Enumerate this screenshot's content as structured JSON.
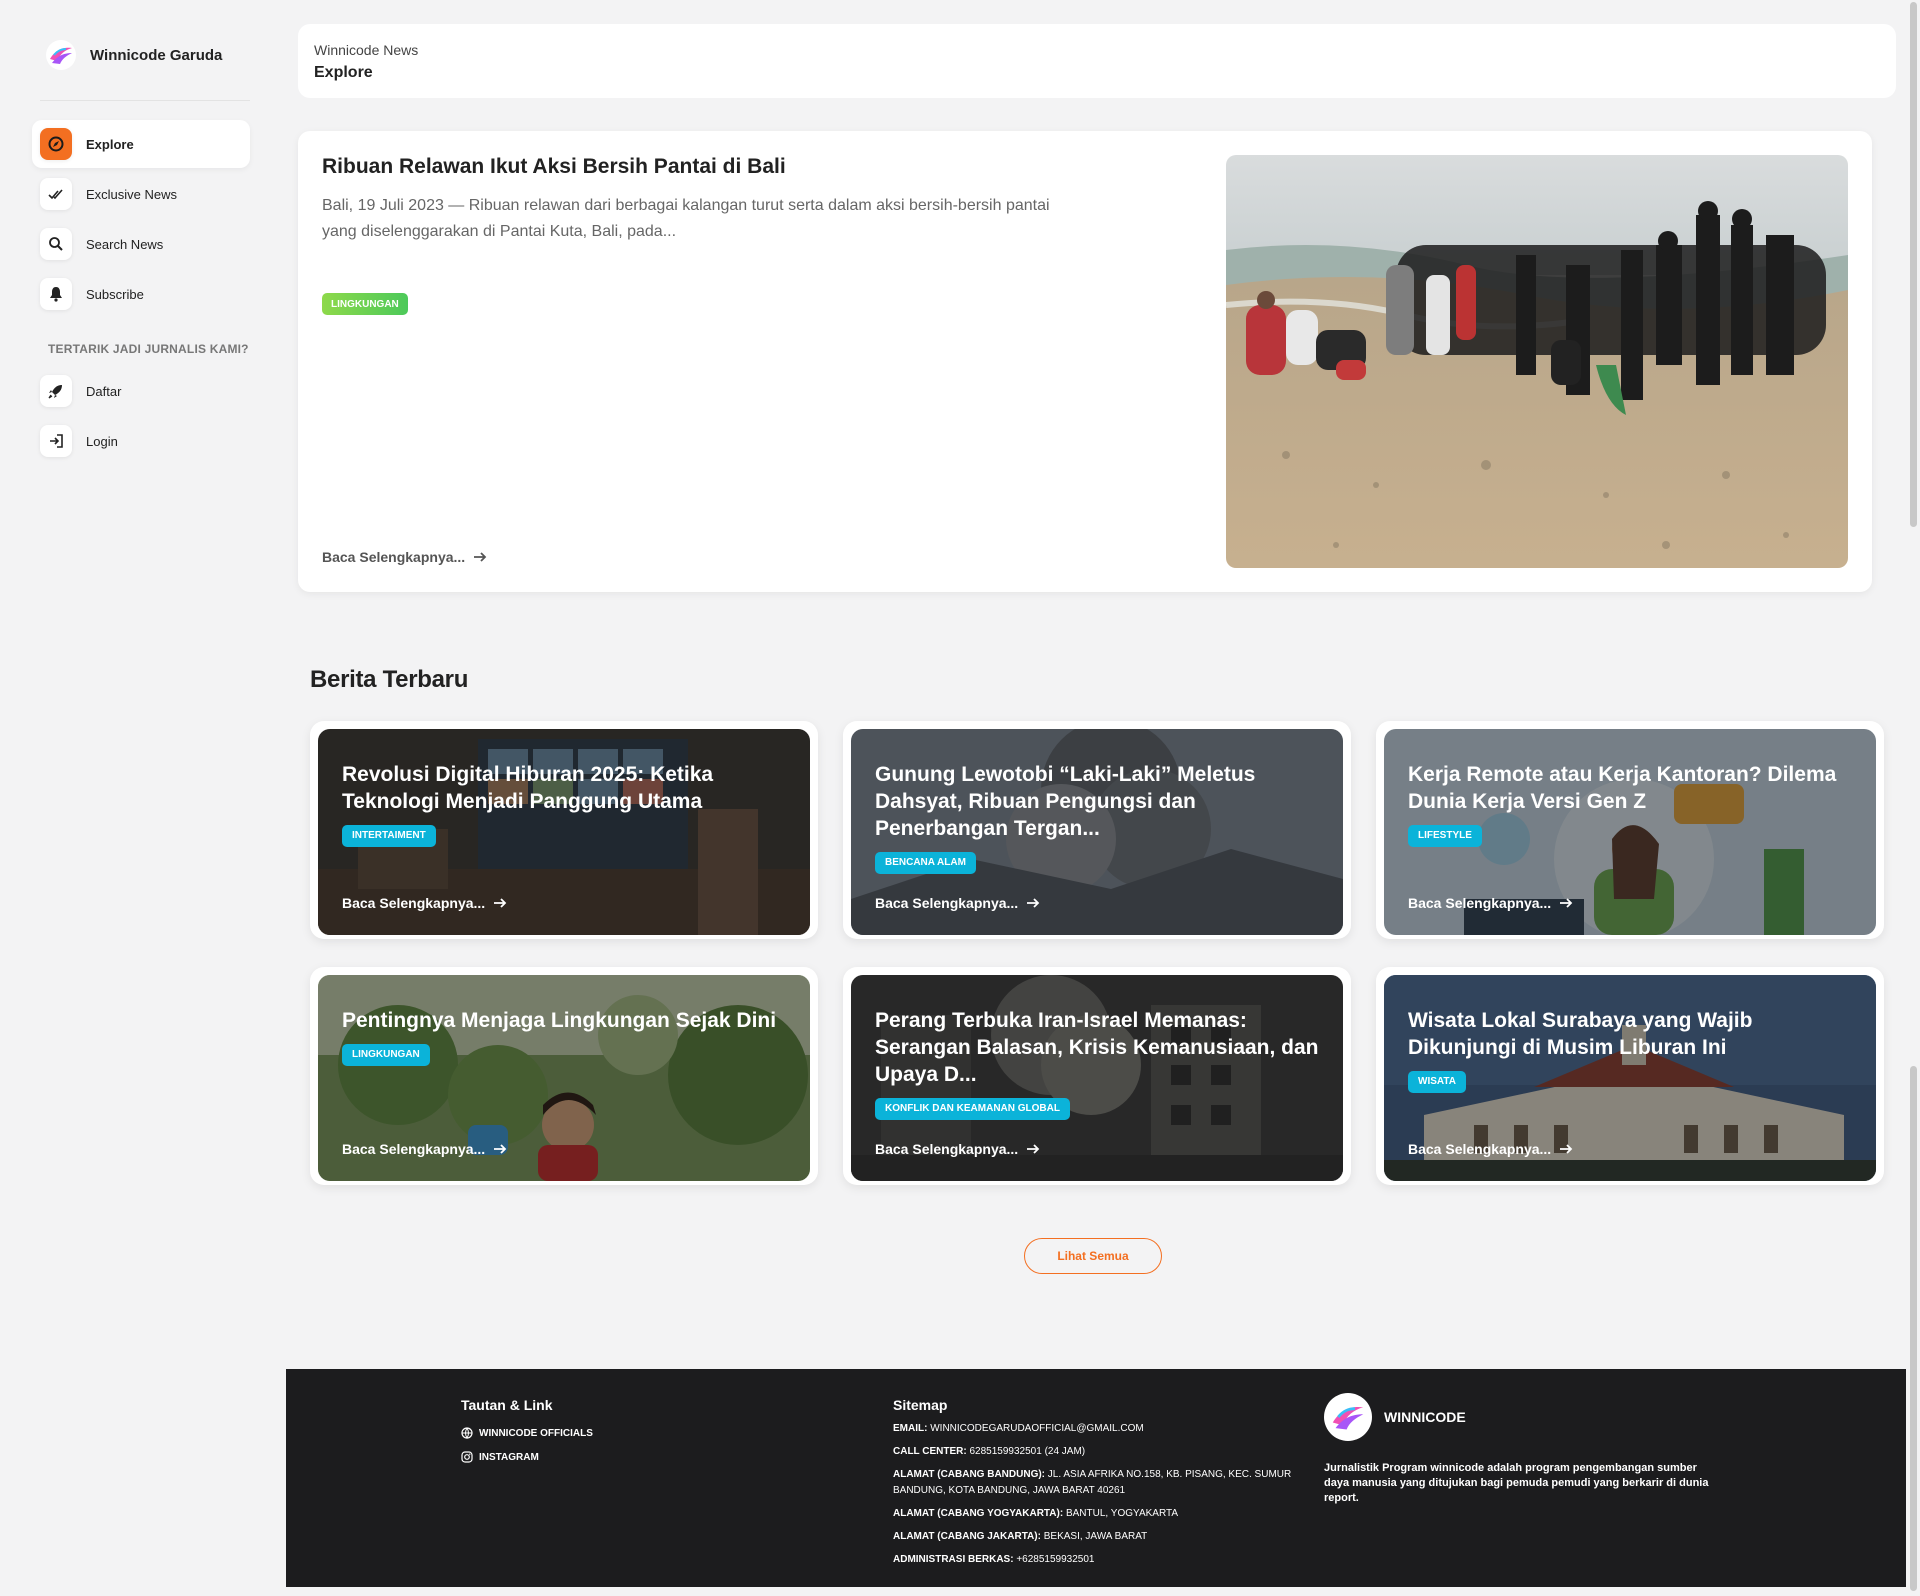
{
  "brand": {
    "name": "Winnicode Garuda"
  },
  "nav": {
    "items": [
      {
        "label": "Explore",
        "icon": "explore-icon"
      },
      {
        "label": "Exclusive News",
        "icon": "check-double-icon"
      },
      {
        "label": "Search News",
        "icon": "search-icon"
      },
      {
        "label": "Subscribe",
        "icon": "bell-icon"
      }
    ],
    "section_label": "TERTARIK JADI JURNALIS KAMI?",
    "account_items": [
      {
        "label": "Daftar",
        "icon": "rocket-icon"
      },
      {
        "label": "Login",
        "icon": "login-icon"
      }
    ]
  },
  "header": {
    "breadcrumb": "Winnicode News",
    "title": "Explore"
  },
  "hero": {
    "title": "Ribuan Relawan Ikut Aksi Bersih Pantai di Bali",
    "excerpt": "Bali, 19 Juli 2023 — Ribuan relawan dari berbagai kalangan turut serta dalam aksi bersih-bersih pantai yang diselenggarakan di Pantai Kuta, Bali, pada...",
    "badge": "LINGKUNGAN",
    "read_more": "Baca Selengkapnya..."
  },
  "latest": {
    "title": "Berita Terbaru",
    "cards": [
      {
        "title": "Revolusi Digital Hiburan 2025: Ketika Teknologi Menjadi Panggung Utama",
        "badge": "INTERTAIMENT",
        "read_more": "Baca Selengkapnya..."
      },
      {
        "title": "Gunung Lewotobi “Laki-Laki” Meletus Dahsyat, Ribuan Pengungsi dan Penerbangan Tergan...",
        "badge": "BENCANA ALAM",
        "read_more": "Baca Selengkapnya..."
      },
      {
        "title": "Kerja Remote atau Kerja Kantoran? Dilema Dunia Kerja Versi Gen Z",
        "badge": "LIFESTYLE",
        "read_more": "Baca Selengkapnya..."
      },
      {
        "title": "Pentingnya Menjaga Lingkungan Sejak Dini",
        "badge": "LINGKUNGAN",
        "read_more": "Baca Selengkapnya..."
      },
      {
        "title": "Perang Terbuka Iran-Israel Memanas: Serangan Balasan, Krisis Kemanusiaan, dan Upaya D...",
        "badge": "KONFLIK DAN KEAMANAN GLOBAL",
        "read_more": "Baca Selengkapnya..."
      },
      {
        "title": "Wisata Lokal Surabaya yang Wajib Dikunjungi di Musim Liburan Ini",
        "badge": "WISATA",
        "read_more": "Baca Selengkapnya..."
      }
    ],
    "see_all": "Lihat Semua"
  },
  "footer": {
    "links_title": "Tautan & Link",
    "links": [
      {
        "label": "WINNICODE OFFICIALS",
        "icon": "globe-icon"
      },
      {
        "label": "INSTAGRAM",
        "icon": "instagram-icon"
      }
    ],
    "sitemap_title": "Sitemap",
    "sitemap": [
      {
        "key": "EMAIL:",
        "value": "WINNICODEGARUDAOFFICIAL@GMAIL.COM"
      },
      {
        "key": "CALL CENTER:",
        "value": "6285159932501 (24 JAM)"
      },
      {
        "key": "ALAMAT (CABANG BANDUNG):",
        "value": "JL. ASIA AFRIKA NO.158, KB. PISANG, KEC. SUMUR BANDUNG, KOTA BANDUNG, JAWA BARAT 40261"
      },
      {
        "key": "ALAMAT (CABANG YOGYAKARTA):",
        "value": "BANTUL, YOGYAKARTA"
      },
      {
        "key": "ALAMAT (CABANG JAKARTA):",
        "value": "BEKASI, JAWA BARAT"
      },
      {
        "key": "ADMINISTRASI BERKAS:",
        "value": "+6285159932501"
      }
    ],
    "brand_name": "WINNICODE",
    "description": "Jurnalistik Program winnicode adalah program pengembangan sumber daya manusia yang ditujukan bagi pemuda pemudi yang berkarir di dunia report."
  },
  "colors": {
    "accent": "#f36f21",
    "badge_blue": "#0bb3d9",
    "badge_green": "#4cc95a",
    "footer_bg": "#1c1c1e"
  }
}
